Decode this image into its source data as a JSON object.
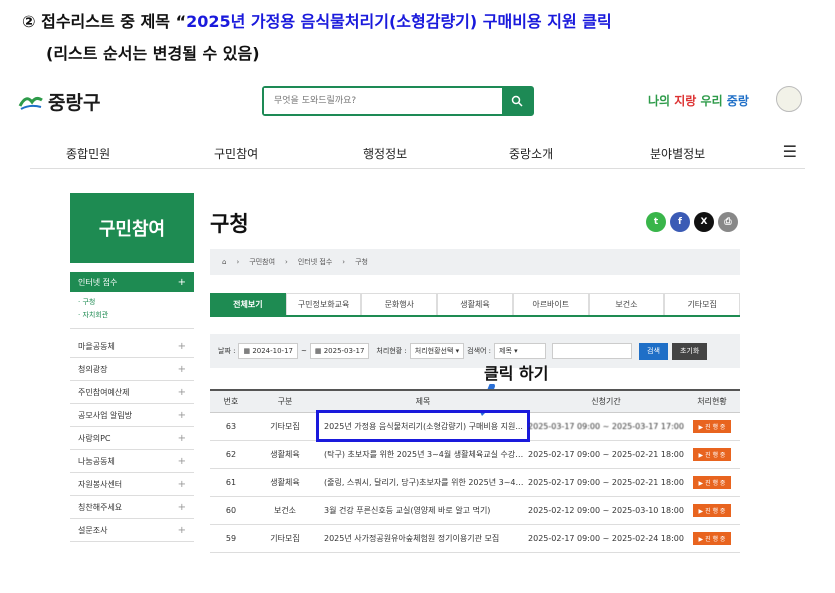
{
  "instruction": {
    "line1_prefix": "② 접수리스트 중 제목 “",
    "line1_highlight": "2025년 가정용 음식물처리기(소형감량기) 구매비용 지원 클릭",
    "line2": "(리스트 순서는 변경될 수 있음)"
  },
  "header": {
    "logo_text": "중랑구",
    "search_placeholder": "무엇을 도와드릴까요?",
    "slogan": {
      "part1": "나의 ",
      "part2": "지랑 ",
      "part3": "우리 ",
      "part4": "중랑"
    }
  },
  "nav": {
    "items": [
      "종합민원",
      "구민참여",
      "행정정보",
      "중랑소개",
      "분야별정보"
    ],
    "menu_icon": "hamburger-icon"
  },
  "sidebar": {
    "title": "구민참여",
    "active_item": "인터넷 접수",
    "sub_items": [
      "구청",
      "자치회관"
    ],
    "items": [
      "마을공동체",
      "청의광장",
      "주민참여예산제",
      "공모사업 알림방",
      "사랑의PC",
      "나눔공동체",
      "자원봉사센터",
      "칭찬해주세요",
      "설문조사"
    ]
  },
  "main": {
    "page_title": "구청",
    "breadcrumb": [
      "구민참여",
      "인터넷 접수",
      "구청"
    ],
    "tabs": [
      "전체보기",
      "구민정보화교육",
      "문화행사",
      "생활체육",
      "아르바이트",
      "보건소",
      "기타모집"
    ],
    "filter": {
      "period_label": "날짜 :",
      "date_from": "2024-10-17",
      "date_to": "2025-03-17",
      "status_label": "처리현황 :",
      "status_value": "처리현황선택",
      "search_label": "검색어 :",
      "search_value": "제목",
      "search_button": "검색",
      "reset_button": "초기화"
    },
    "annotation": "클릭 하기",
    "table": {
      "headers": [
        "번호",
        "구분",
        "제목",
        "신청기간",
        "처리현황"
      ],
      "rows": [
        {
          "no": "63",
          "category": "기타모집",
          "title": "2025년 가정용 음식물처리기(소형감량기) 구매비용 지원...",
          "period": "2025-03-17 09:00 ~ 2025-03-17 17:00",
          "status": "▶ 진 행 중"
        },
        {
          "no": "62",
          "category": "생활체육",
          "title": "(탁구) 초보자를 위한 2025년 3~4월 생활체육교실 수강생...",
          "period": "2025-02-17 09:00 ~ 2025-02-21 18:00",
          "status": "▶ 진 행 중"
        },
        {
          "no": "61",
          "category": "생활체육",
          "title": "(줄링, 스쿼시, 달리기, 당구)초보자를 위한 2025년 3~4월...",
          "period": "2025-02-17 09:00 ~ 2025-02-21 18:00",
          "status": "▶ 진 행 중"
        },
        {
          "no": "60",
          "category": "보건소",
          "title": "3월 건강 푸른신호등 교실(영양제 바로 알고 먹기)",
          "period": "2025-02-12 09:00 ~ 2025-03-10 18:00",
          "status": "▶ 진 행 중"
        },
        {
          "no": "59",
          "category": "기타모집",
          "title": "2025년 사가정공원유아숲체험원 정기이용기관 모집",
          "period": "2025-02-17 09:00 ~ 2025-02-24 18:00",
          "status": "▶ 진 행 중"
        }
      ]
    }
  },
  "colors": {
    "brand_green": "#1e8b52",
    "highlight_blue": "#1a1adc",
    "status_orange": "#e8641f"
  }
}
